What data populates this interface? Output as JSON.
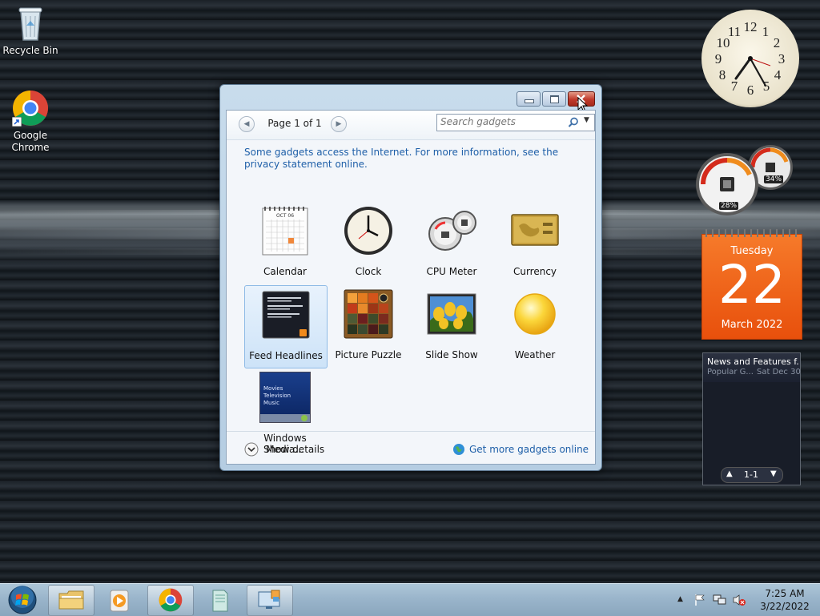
{
  "desktop": {
    "icons": [
      {
        "label": "Recycle Bin",
        "icon": "recycle-bin-icon"
      },
      {
        "label": "Google\nChrome",
        "icon": "chrome-icon"
      }
    ]
  },
  "gadget_window": {
    "page_label": "Page 1 of 1",
    "search_placeholder": "Search gadgets",
    "info_text": "Some gadgets access the Internet.  For more information, see the privacy statement online.",
    "gadgets": [
      {
        "label": "Calendar",
        "icon": "calendar-gadget-icon"
      },
      {
        "label": "Clock",
        "icon": "clock-gadget-icon"
      },
      {
        "label": "CPU Meter",
        "icon": "cpu-meter-gadget-icon"
      },
      {
        "label": "Currency",
        "icon": "currency-gadget-icon"
      },
      {
        "label": "Feed Headlines",
        "icon": "feed-headlines-gadget-icon",
        "selected": true
      },
      {
        "label": "Picture Puzzle",
        "icon": "picture-puzzle-gadget-icon"
      },
      {
        "label": "Slide Show",
        "icon": "slide-show-gadget-icon"
      },
      {
        "label": "Weather",
        "icon": "weather-gadget-icon"
      },
      {
        "label": "Windows Media...",
        "icon": "windows-media-center-gadget-icon"
      }
    ],
    "calendar_thumb_month": "OCT 06",
    "wmc_thumb_lines": [
      "Movies",
      "Television",
      "Music"
    ],
    "show_details_label": "Show details",
    "get_more_label": "Get more gadgets online"
  },
  "desktop_gadgets": {
    "clock_numbers": [
      "12",
      "1",
      "2",
      "3",
      "4",
      "5",
      "6",
      "7",
      "8",
      "9",
      "10",
      "11"
    ],
    "cpu_meter": {
      "cpu_percent": "28%",
      "memory_percent": "34%"
    },
    "calendar": {
      "weekday": "Tuesday",
      "day": "22",
      "month_year": "March 2022"
    },
    "feed": {
      "title": "News and Features f...",
      "source": "Popular G...",
      "date": "Sat Dec 30",
      "pager": "1-1"
    }
  },
  "taskbar": {
    "apps": [
      "start-orb",
      "explorer",
      "media-player",
      "chrome",
      "document",
      "gadgets"
    ],
    "time": "7:25 AM",
    "date": "3/22/2022"
  },
  "colors": {
    "accent_link": "#1e5fa8",
    "calendar_orange": "#ee5a12",
    "close_red": "#c0392b"
  }
}
